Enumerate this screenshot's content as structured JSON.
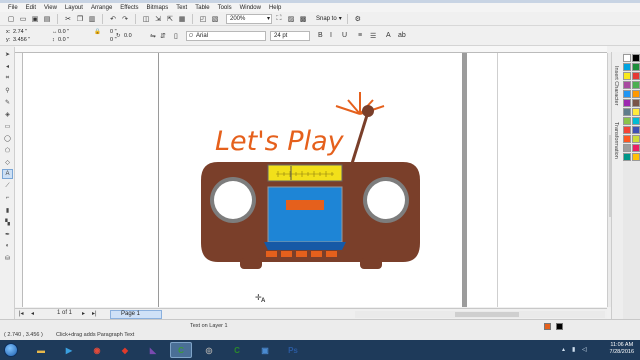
{
  "menubar": {
    "items": [
      {
        "label": "File"
      },
      {
        "label": "Edit"
      },
      {
        "label": "View"
      },
      {
        "label": "Layout"
      },
      {
        "label": "Arrange"
      },
      {
        "label": "Effects"
      },
      {
        "label": "Bitmaps"
      },
      {
        "label": "Text"
      },
      {
        "label": "Table"
      },
      {
        "label": "Tools"
      },
      {
        "label": "Window"
      },
      {
        "label": "Help"
      }
    ]
  },
  "toolbar": {
    "zoom_value": "200%",
    "snap_label": "Snap to"
  },
  "property_bar": {
    "x_label": "x:",
    "x_value": "2.74 \"",
    "y_label": "y:",
    "y_value": "3.456 \"",
    "w_value": "0.0 \"",
    "h_value": "0.0 \"",
    "scale_x": "0 \"",
    "scale_y": "0 \"",
    "rotation": "0.0",
    "font_name": "Arial",
    "font_size": "24 pt"
  },
  "artwork": {
    "title_text": "Let's Play",
    "colors": {
      "body": "#7a3f2a",
      "accent_orange": "#e5601c",
      "speaker_ring": "#7d7d7d",
      "tuner": "#f2e01a",
      "cassette": "#1e85d6",
      "tray": "#1659a6"
    }
  },
  "pagenav": {
    "page_count": "1 of 1",
    "page_tab": "Page 1"
  },
  "docker": {
    "tab_insert_character": "Insert Character",
    "tab_transformation": "Transformation"
  },
  "palette": {
    "colors": [
      "#ffffff",
      "#000000",
      "#00a3e0",
      "#1e8f3c",
      "#f8e81c",
      "#e53935",
      "#a84aa0",
      "#4caf50",
      "#2196f3",
      "#ff9800",
      "#9c27b0",
      "#795548",
      "#607d8b",
      "#ffeb3b",
      "#8bc34a",
      "#00bcd4",
      "#f44336",
      "#3f51b5",
      "#ff5722",
      "#cddc39",
      "#9e9e9e",
      "#e91e63",
      "#009688",
      "#ffc107"
    ]
  },
  "statusbar": {
    "coords": "( 2.740 , 3.456 )",
    "hint": "Click+drag adds Paragraph Text",
    "layer": "Text on Layer 1"
  },
  "taskbar": {
    "time": "11:06 AM",
    "date": "7/28/2016",
    "apps": [
      {
        "name": "explorer",
        "glyph": "▬",
        "color": "#e8b84a"
      },
      {
        "name": "media",
        "glyph": "▶",
        "color": "#3aa0e0"
      },
      {
        "name": "chrome",
        "glyph": "◉",
        "color": "#e04a3a"
      },
      {
        "name": "app-red",
        "glyph": "◆",
        "color": "#e03a2a"
      },
      {
        "name": "visual-studio",
        "glyph": "◣",
        "color": "#7a4ab0"
      },
      {
        "name": "coreldraw",
        "glyph": "C",
        "color": "#3a9a3a"
      },
      {
        "name": "camera",
        "glyph": "◎",
        "color": "#aaaaaa"
      },
      {
        "name": "coreldraw2",
        "glyph": "C",
        "color": "#2a8a2a"
      },
      {
        "name": "photo",
        "glyph": "▣",
        "color": "#4a8ad0"
      },
      {
        "name": "photoshop",
        "glyph": "Ps",
        "color": "#2a5aa0"
      }
    ]
  }
}
